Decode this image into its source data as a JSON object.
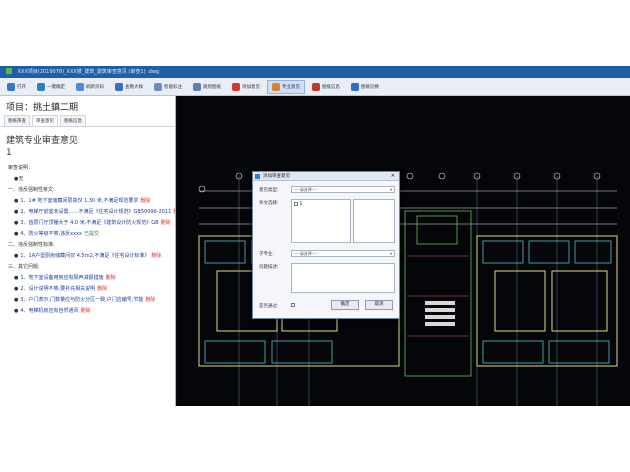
{
  "window": {
    "title": "XXX项目(2019078)_XXX楼_建筑_建筑审查意见 (审查1) .dwg"
  },
  "toolbar": {
    "items": [
      {
        "label": "打开",
        "color": "#3b77c4",
        "active": false
      },
      {
        "label": "一键确定",
        "color": "#2e7fbf",
        "active": false
      },
      {
        "label": "刷新页码",
        "color": "#4a8fd6",
        "active": false
      },
      {
        "label": "查看大样",
        "color": "#3c6fb4",
        "active": false
      },
      {
        "label": "智能标注",
        "color": "#6c8dc1",
        "active": false
      },
      {
        "label": "跳到图纸",
        "color": "#5a7fb0",
        "active": false
      },
      {
        "label": "添加意见",
        "color": "#d23535",
        "active": false
      },
      {
        "label": "专业意见",
        "color": "#d9822b",
        "active": true
      },
      {
        "label": "图纸信息",
        "color": "#c0392b",
        "active": false
      },
      {
        "label": "图纸切换",
        "color": "#2f6fc2",
        "active": false
      }
    ]
  },
  "left": {
    "project_title": "项目：挑土鎮二期",
    "tabs": [
      "图纸审查",
      "审查意见",
      "图纸信息"
    ],
    "opinion_title": "建筑专业审查意见",
    "opinion_num": "1",
    "review_label": "审查说明：",
    "none": "●无",
    "items": [
      {
        "text": "一、违反强制性条文:",
        "type": "section"
      },
      {
        "text": "1、1# 地下室储藏间层高仅 1.30 米,不满足规范要求",
        "type": "item",
        "tag": "删除"
      },
      {
        "text": "2、电梯厅前室未设置……不满足《住宅设计规范》GB50096-2011",
        "type": "item",
        "tag": "删除"
      },
      {
        "text": "3、首层门厅顶棚大于 4.0 米,不满足《建筑设计防火规范》GB",
        "type": "item",
        "tag": "删除"
      },
      {
        "text": "4、防火等级不够,违反xxxx",
        "type": "item",
        "tag": "已提交",
        "tag_color": "green"
      },
      {
        "text": "二、违反强制性标准:",
        "type": "section"
      },
      {
        "text": "1、1A户型厨房储藏间仅 4.5m2,不满足《住宅设计标准》",
        "type": "item",
        "tag": "删除"
      },
      {
        "text": "三、其它问题:",
        "type": "section"
      },
      {
        "text": "1、地下室设备用房应有隔声减振措施",
        "type": "item",
        "tag": "删除"
      },
      {
        "text": "2、设计说明不够,要补充相关说明",
        "type": "item",
        "tag": "删除"
      },
      {
        "text": "3、户门表示,门数量应与防火分区一致,户门应编号,节能",
        "type": "item",
        "tag": "删除"
      },
      {
        "text": "4、电梯机房应有自然通风",
        "type": "item",
        "tag": "删除"
      }
    ]
  },
  "dialog": {
    "title": "添加审查意见",
    "type_label": "意见类型:",
    "type_placeholder": "----请选择----",
    "clause_label": "条文选择:",
    "clause_value": "1",
    "sub_label": "子专业:",
    "sub_placeholder": "----请选择----",
    "problem_label": "问题描述:",
    "ok_label": "确定",
    "cancel_label": "取消",
    "confirm_label": "是否通过:"
  }
}
